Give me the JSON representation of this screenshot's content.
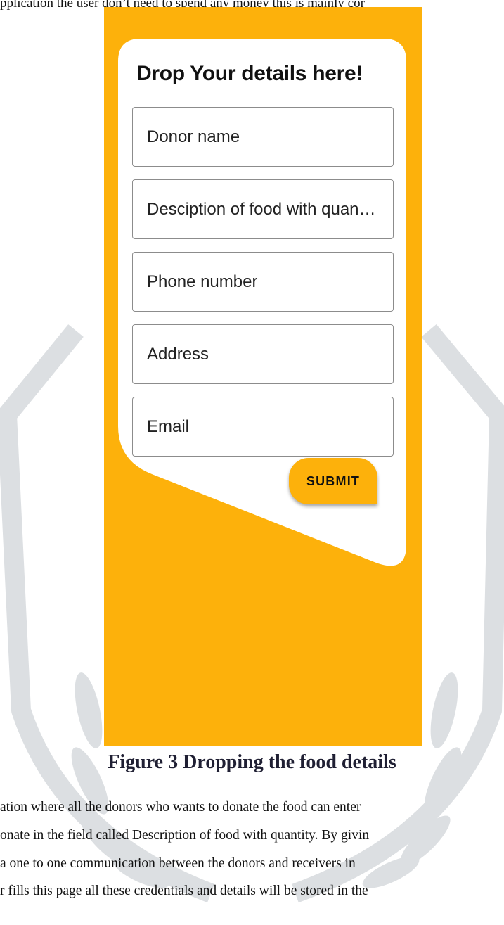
{
  "intro_text": {
    "before_underline": "pplication the ",
    "underlined": "user don’t need to spend any money this",
    "after_underline": " is mainly cor"
  },
  "form": {
    "title": "Drop Your details here!",
    "fields": [
      {
        "placeholder": "Donor name"
      },
      {
        "placeholder": "Desciption of food with quantity"
      },
      {
        "placeholder": "Phone number"
      },
      {
        "placeholder": "Address"
      },
      {
        "placeholder": "Email"
      }
    ],
    "submit_label": "SUBMIT"
  },
  "colors": {
    "background": "#FDB10B",
    "card": "#FFFFFF",
    "watermark": "#DCDFE2"
  },
  "caption": "Figure 3 Dropping the food details",
  "body_lines": [
    "ation where all the donors who wants to donate the food can enter",
    "onate in the field called Description of food with quantity. By givin",
    " a one to one communication between the donors and receivers in",
    "r fills this page all these credentials and details will be stored in the"
  ]
}
